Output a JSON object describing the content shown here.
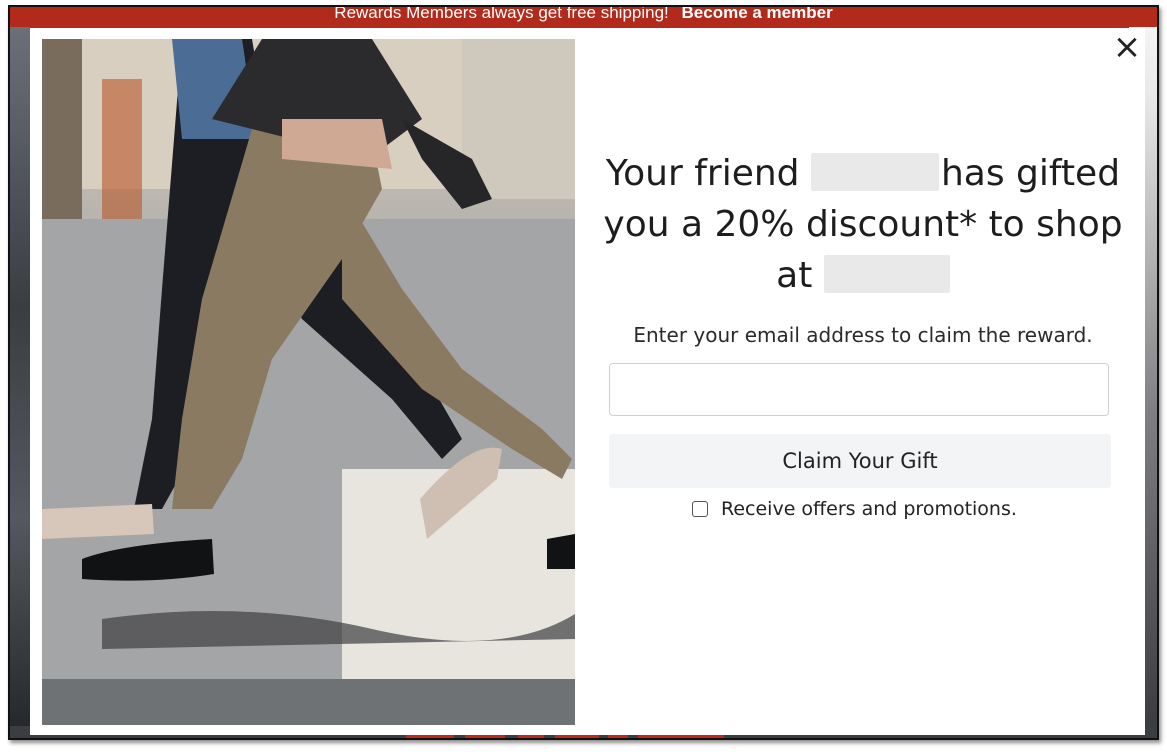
{
  "promo_bar": {
    "text": "Rewards Members always get free shipping!",
    "link": "Become a member"
  },
  "modal": {
    "close_glyph": "×",
    "headline": {
      "line1_before": "Your friend",
      "line1_after": "has gifted",
      "line2": "you a 20% discount* to shop",
      "line3_before": "at"
    },
    "subtext": "Enter your email address to claim the reward.",
    "email_input": {
      "value": "",
      "placeholder": ""
    },
    "claim_button": "Claim Your Gift",
    "optin_label": "Receive offers and promotions.",
    "optin_checked": false
  },
  "icons": {
    "close": "close-icon",
    "checkbox": "checkbox-icon"
  },
  "colors": {
    "promo_bar": "#b22a1c",
    "button_bg": "#f3f4f5",
    "modal_bg": "#ffffff"
  }
}
